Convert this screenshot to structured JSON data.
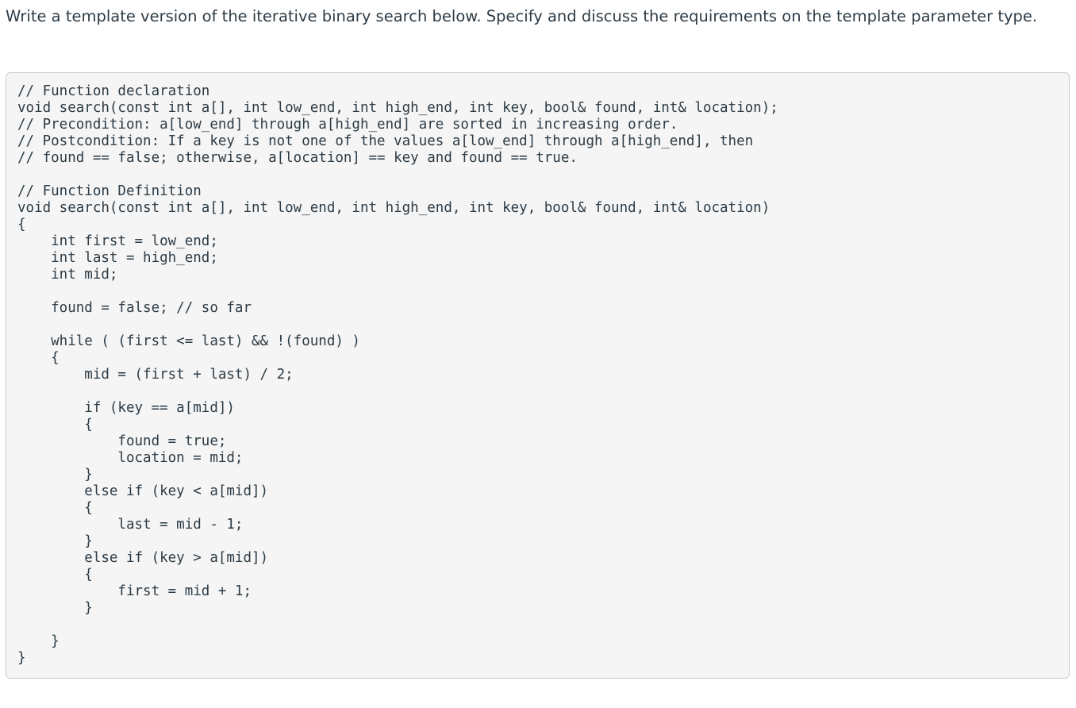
{
  "question": {
    "text": "Write a template version of the iterative binary search below. Specify and discuss the requirements on the template parameter type."
  },
  "code": {
    "lines": [
      "// Function declaration",
      "void search(const int a[], int low_end, int high_end, int key, bool& found, int& location);",
      "// Precondition: a[low_end] through a[high_end] are sorted in increasing order.",
      "// Postcondition: If a key is not one of the values a[low_end] through a[high_end], then",
      "// found == false; otherwise, a[location] == key and found == true.",
      "",
      "// Function Definition",
      "void search(const int a[], int low_end, int high_end, int key, bool& found, int& location)",
      "{",
      "    int first = low_end;",
      "    int last = high_end;",
      "    int mid;",
      "",
      "    found = false; // so far",
      "",
      "    while ( (first <= last) && !(found) )",
      "    {",
      "        mid = (first + last) / 2;",
      "",
      "        if (key == a[mid])",
      "        {",
      "            found = true;",
      "            location = mid;",
      "        }",
      "        else if (key < a[mid])",
      "        {",
      "            last = mid - 1;",
      "        }",
      "        else if (key > a[mid])",
      "        {",
      "            first = mid + 1;",
      "        }",
      "",
      "    }",
      "}"
    ]
  }
}
